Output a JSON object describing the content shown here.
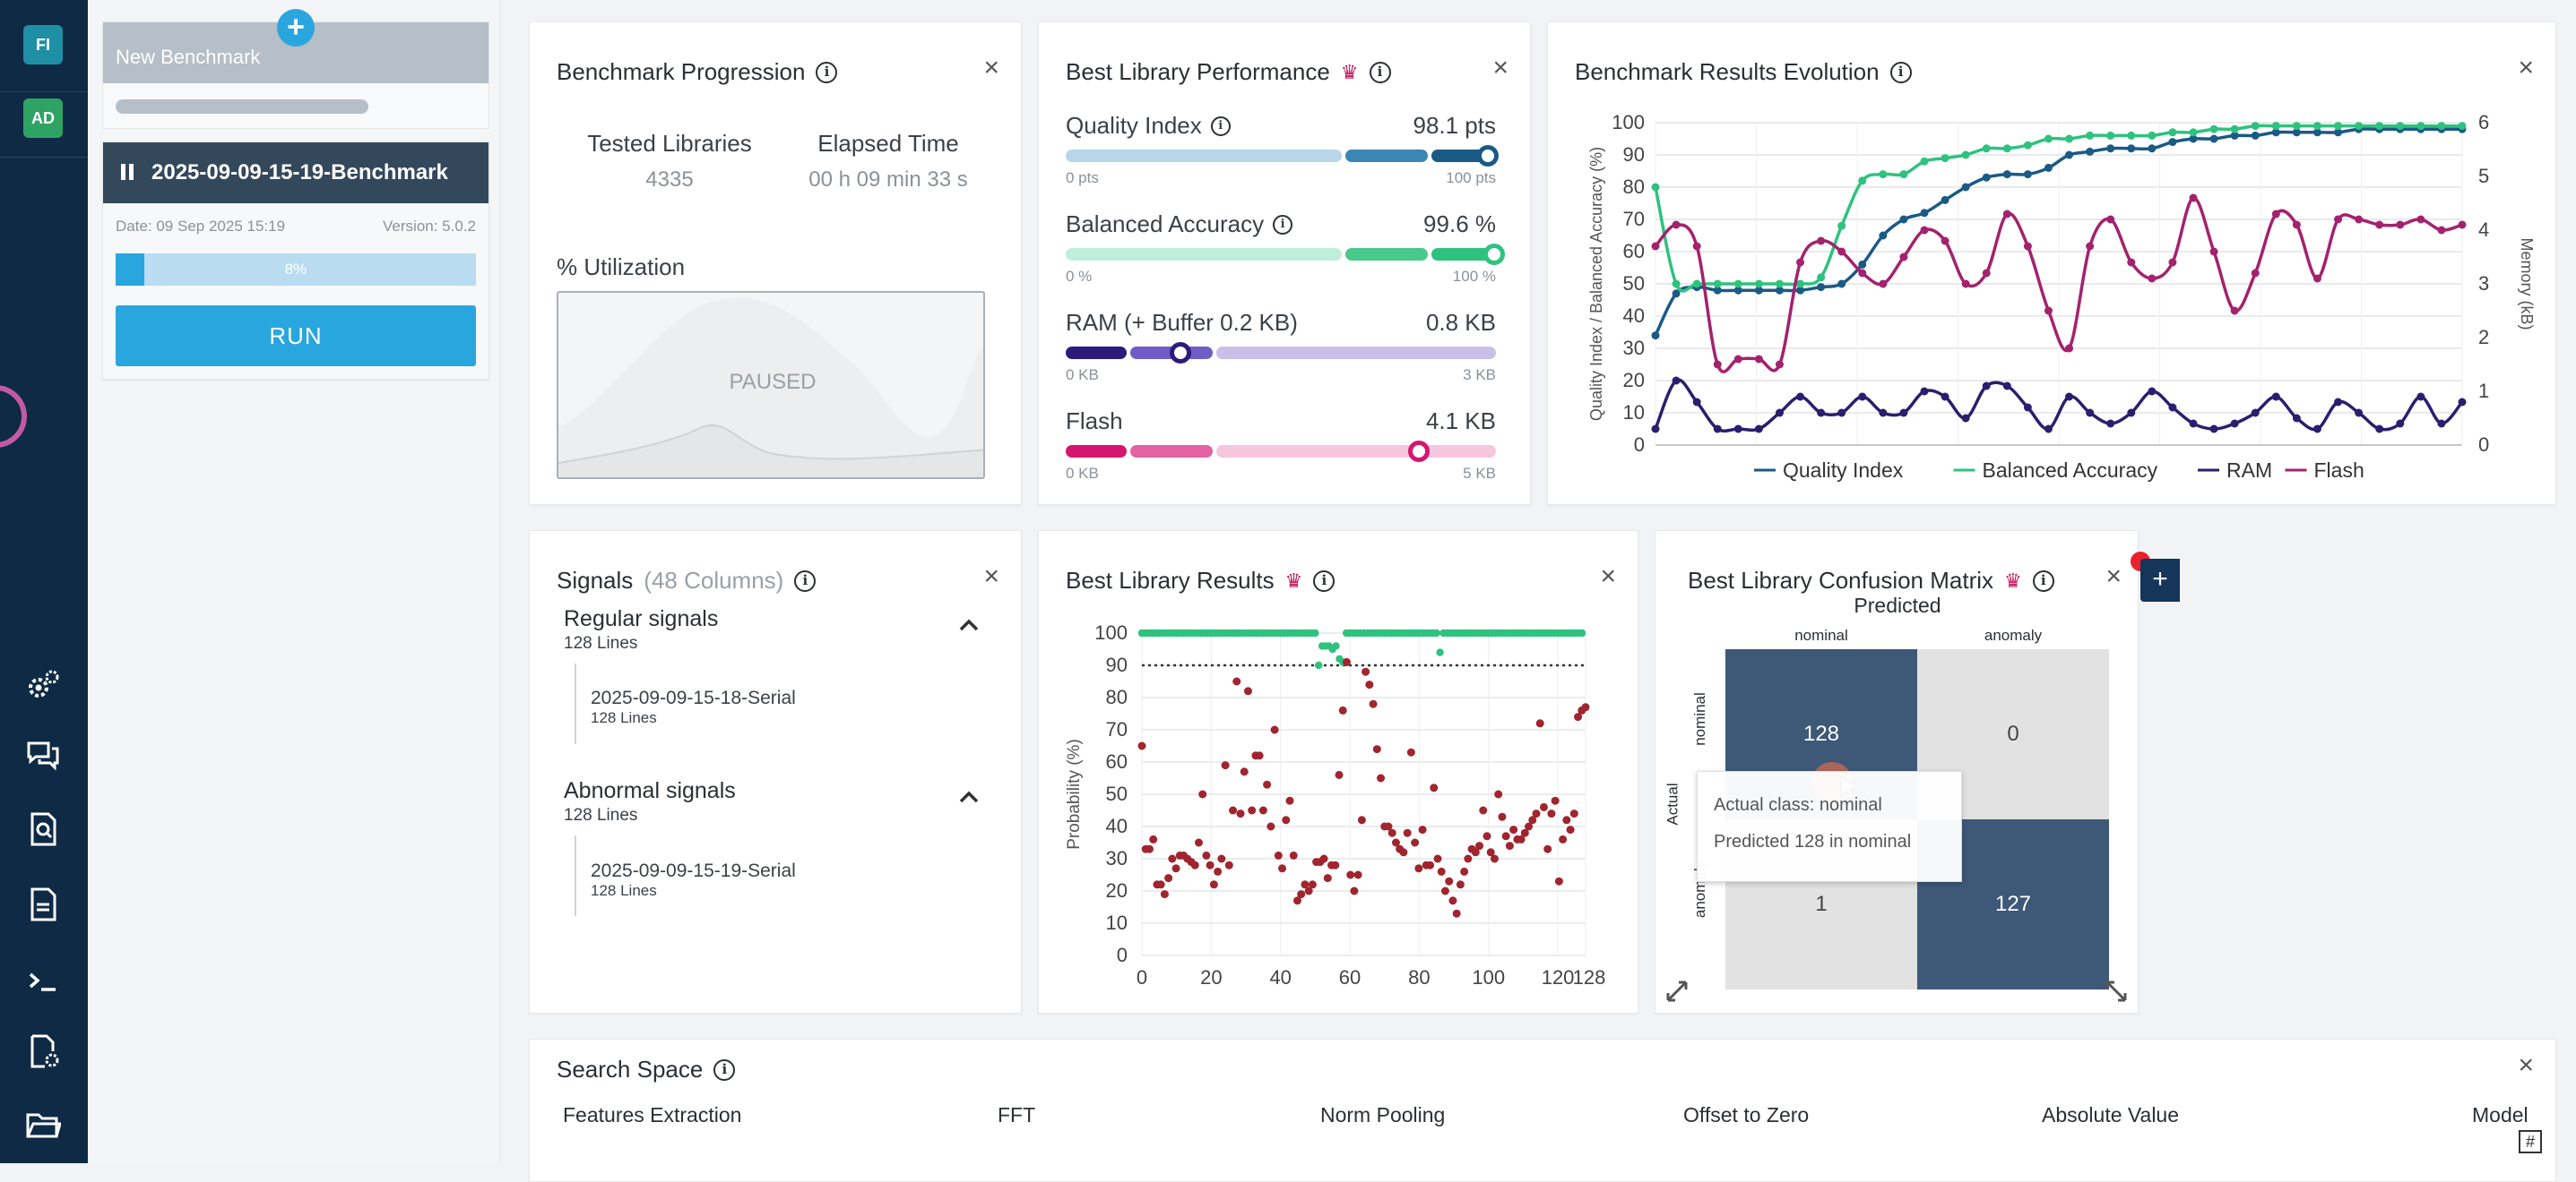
{
  "nav": {
    "avatars": [
      {
        "text": "FI",
        "color": "#1f8fa6"
      },
      {
        "text": "AD",
        "color": "#2ea363"
      }
    ],
    "icons": [
      "gear-icon",
      "chat-icon",
      "search-doc-icon",
      "document-icon",
      "terminal-icon",
      "file-settings-icon",
      "folder-icon"
    ]
  },
  "left": {
    "new_benchmark": "New Benchmark",
    "active_title": "2025-09-09-15-19-Benchmark",
    "date": "Date: 09 Sep 2025 15:19",
    "version": "Version: 5.0.2",
    "progress_text": "8%",
    "progress_fraction": 0.08,
    "run_label": "RUN"
  },
  "progression": {
    "title": "Benchmark Progression",
    "tested_label": "Tested Libraries",
    "tested_value": "4335",
    "elapsed_label": "Elapsed Time",
    "elapsed_value": "00 h 09 min 33 s",
    "util_label": "% Utilization",
    "paused": "PAUSED"
  },
  "performance": {
    "title": "Best Library Performance",
    "metrics": [
      {
        "name": "Quality Index",
        "value": "98.1 pts",
        "min": "0 pts",
        "max": "100 pts",
        "fraction": 0.981
      },
      {
        "name": "Balanced Accuracy",
        "value": "99.6 %",
        "min": "0 %",
        "max": "100 %",
        "fraction": 0.996
      },
      {
        "name": "RAM (+ Buffer 0.2 KB)",
        "value": "0.8 KB",
        "min": "0 KB",
        "max": "3 KB",
        "fraction": 0.267
      },
      {
        "name": "Flash",
        "value": "4.1 KB",
        "min": "0 KB",
        "max": "5 KB",
        "fraction": 0.82
      }
    ]
  },
  "evolution": {
    "title": "Benchmark Results Evolution",
    "legend": [
      "Quality Index",
      "Balanced Accuracy",
      "RAM",
      "Flash"
    ]
  },
  "signals": {
    "title": "Signals",
    "count": "(48 Columns)",
    "groups": [
      {
        "name": "Regular signals",
        "lines": "128 Lines",
        "item": "2025-09-09-15-18-Serial",
        "item_lines": "128 Lines"
      },
      {
        "name": "Abnormal signals",
        "lines": "128 Lines",
        "item": "2025-09-09-15-19-Serial",
        "item_lines": "128 Lines"
      }
    ]
  },
  "results": {
    "title": "Best Library Results"
  },
  "confusion": {
    "title": "Best Library Confusion Matrix",
    "predicted_label": "Predicted",
    "actual_label": "Actual",
    "col_labels": [
      "nominal",
      "anomaly"
    ],
    "row_labels": [
      "nominal",
      "anomaly"
    ],
    "cells": [
      "128",
      "0",
      "1",
      "127"
    ],
    "tooltip_line1": "Actual class: nominal",
    "tooltip_line2": "Predicted 128 in nominal"
  },
  "search_space": {
    "title": "Search Space",
    "columns": [
      "Features Extraction",
      "FFT",
      "Norm Pooling",
      "Offset to Zero",
      "Absolute Value",
      "Model"
    ]
  },
  "chart_data": [
    {
      "type": "line",
      "title": "Benchmark Results Evolution",
      "ylabel": "Quality Index / Balanced Accuracy (%)",
      "y2label": "Memory (kB)",
      "ylim": [
        0,
        100
      ],
      "y2lim": [
        0,
        6
      ],
      "yticks": [
        0,
        10,
        20,
        30,
        40,
        50,
        60,
        70,
        80,
        90,
        100
      ],
      "y2ticks": [
        0,
        1,
        2,
        3,
        4,
        5,
        6
      ],
      "grid": true,
      "legend_position": "bottom",
      "series": [
        {
          "name": "Quality Index",
          "axis": "left",
          "color": "#1a5a85",
          "values": [
            34,
            47,
            49,
            48,
            48,
            48,
            48,
            48,
            49,
            50,
            56,
            65,
            70,
            72,
            76,
            80,
            83,
            84,
            84,
            86,
            90,
            91,
            92,
            92,
            92,
            94,
            95,
            95,
            96,
            96,
            97,
            97,
            97,
            97,
            98,
            98,
            98,
            98,
            98,
            98
          ]
        },
        {
          "name": "Balanced Accuracy",
          "axis": "left",
          "color": "#2ec27e",
          "values": [
            80,
            50,
            50,
            50,
            50,
            50,
            50,
            50,
            52,
            68,
            82,
            84,
            84,
            88,
            89,
            90,
            92,
            92,
            93,
            95,
            95,
            96,
            96,
            96,
            96,
            97,
            97,
            98,
            98,
            99,
            99,
            99,
            99,
            99,
            99,
            99,
            99,
            99,
            99,
            99
          ]
        },
        {
          "name": "RAM",
          "axis": "right",
          "color": "#2a1f6e",
          "values": [
            0.3,
            1.2,
            0.8,
            0.3,
            0.3,
            0.3,
            0.6,
            0.9,
            0.6,
            0.6,
            0.9,
            0.6,
            0.6,
            1.0,
            0.9,
            0.5,
            1.1,
            1.1,
            0.7,
            0.3,
            0.9,
            0.6,
            0.4,
            0.6,
            1.0,
            0.7,
            0.4,
            0.3,
            0.4,
            0.6,
            0.9,
            0.5,
            0.3,
            0.8,
            0.6,
            0.3,
            0.4,
            0.9,
            0.4,
            0.8
          ]
        },
        {
          "name": "Flash",
          "axis": "right",
          "color": "#a3226e",
          "values": [
            3.7,
            4.1,
            3.7,
            1.5,
            1.6,
            1.6,
            1.5,
            3.4,
            3.8,
            3.6,
            3.2,
            3.0,
            3.5,
            4.0,
            3.8,
            3.0,
            3.2,
            4.3,
            3.7,
            2.5,
            1.8,
            3.7,
            4.2,
            3.4,
            3.1,
            3.4,
            4.6,
            3.6,
            2.5,
            3.2,
            4.3,
            4.1,
            3.1,
            4.2,
            4.2,
            4.1,
            4.1,
            4.2,
            4.0,
            4.1
          ]
        }
      ]
    },
    {
      "type": "scatter",
      "title": "Best Library Results",
      "ylabel": "Probability (%)",
      "xlim": [
        0,
        128
      ],
      "ylim": [
        0,
        100
      ],
      "xticks": [
        0,
        20,
        40,
        60,
        80,
        100,
        120,
        128
      ],
      "yticks": [
        0,
        10,
        20,
        30,
        40,
        50,
        60,
        70,
        80,
        90,
        100
      ],
      "threshold": 90,
      "grid": true,
      "series": [
        {
          "name": "nominal",
          "color": "#2ec27e",
          "x": [
            51,
            52,
            53,
            54,
            55,
            56,
            57,
            58,
            86
          ],
          "y": [
            90,
            96,
            96,
            96,
            95,
            96,
            92,
            91,
            94
          ],
          "at_100_except": [
            51,
            52,
            53,
            54,
            55,
            56,
            57,
            58,
            86
          ]
        },
        {
          "name": "anomaly",
          "color": "#a0252e",
          "values": [
            65,
            33,
            33,
            36,
            22,
            22,
            19,
            24,
            30,
            27,
            31,
            31,
            30,
            29,
            28,
            35,
            50,
            31,
            28,
            22,
            26,
            30,
            59,
            28,
            45,
            85,
            44,
            57,
            82,
            45,
            62,
            62,
            45,
            53,
            40,
            70,
            31,
            27,
            42,
            48,
            31,
            17,
            19,
            22,
            20,
            22,
            29,
            29,
            30,
            24,
            28,
            28,
            56,
            76,
            91,
            25,
            20,
            25,
            42,
            88,
            84,
            78,
            64,
            55,
            40,
            40,
            38,
            35,
            33,
            32,
            38,
            63,
            35,
            27,
            39,
            28,
            28,
            52,
            30,
            26,
            20,
            23,
            17,
            13,
            22,
            26,
            30,
            33,
            32,
            34,
            45,
            37,
            32,
            30,
            50,
            43,
            37,
            34,
            39,
            36,
            36,
            38,
            40,
            42,
            44,
            72,
            46,
            33,
            44,
            48,
            23,
            36,
            42,
            39,
            44,
            74,
            76,
            77
          ]
        }
      ]
    },
    {
      "type": "heatmap",
      "title": "Best Library Confusion Matrix",
      "x_categories": [
        "nominal",
        "anomaly"
      ],
      "y_categories": [
        "nominal",
        "anomaly"
      ],
      "values": [
        [
          128,
          0
        ],
        [
          1,
          127
        ]
      ]
    }
  ]
}
